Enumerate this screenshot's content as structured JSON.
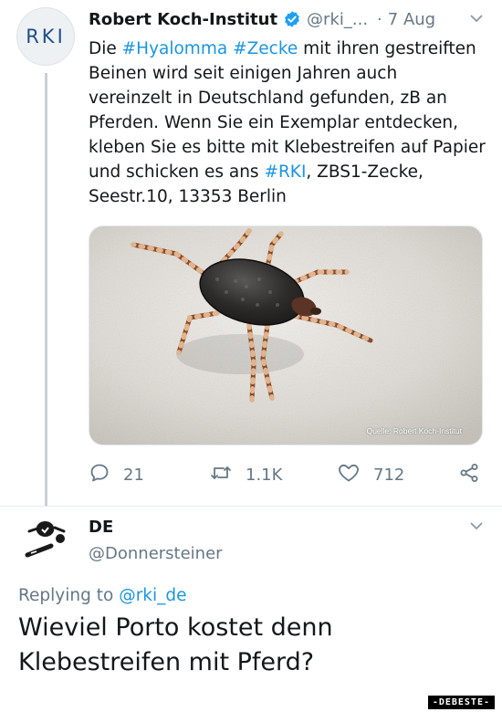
{
  "tweet": {
    "avatar_text": "RKI",
    "author_name": "Robert Koch-Institut",
    "handle": "@rki_...",
    "separator": "·",
    "date": "7 Aug",
    "text": {
      "t1": "Die ",
      "tag1": "#Hyalomma",
      "t2": " ",
      "tag2": "#Zecke",
      "t3": " mit ihren gestreiften Beinen wird seit einigen Jahren auch vereinzelt in Deutschland gefunden, zB an Pferden. Wenn Sie ein Exemplar entdecken, kleben Sie es bitte mit Klebestreifen auf Papier und schicken es ans ",
      "tag3": "#RKI",
      "t4": ", ZBS1-Zecke, Seestr.10, 13353 Berlin"
    },
    "image_credit": "Quelle: Robert Koch-Institut",
    "stats": {
      "replies": "21",
      "retweets": "1.1K",
      "likes": "712"
    }
  },
  "reply": {
    "author_name": "DE",
    "handle": "@Donnersteiner",
    "replying_prefix": "Replying to ",
    "replying_to": "@rki_de",
    "text": "Wieviel Porto kostet denn Klebestreifen mit Pferd?"
  },
  "watermark": "-DEBESTE-",
  "colors": {
    "link": "#1b95e0",
    "muted": "#657786",
    "verified": "#1da1f2",
    "text": "#14171a"
  }
}
